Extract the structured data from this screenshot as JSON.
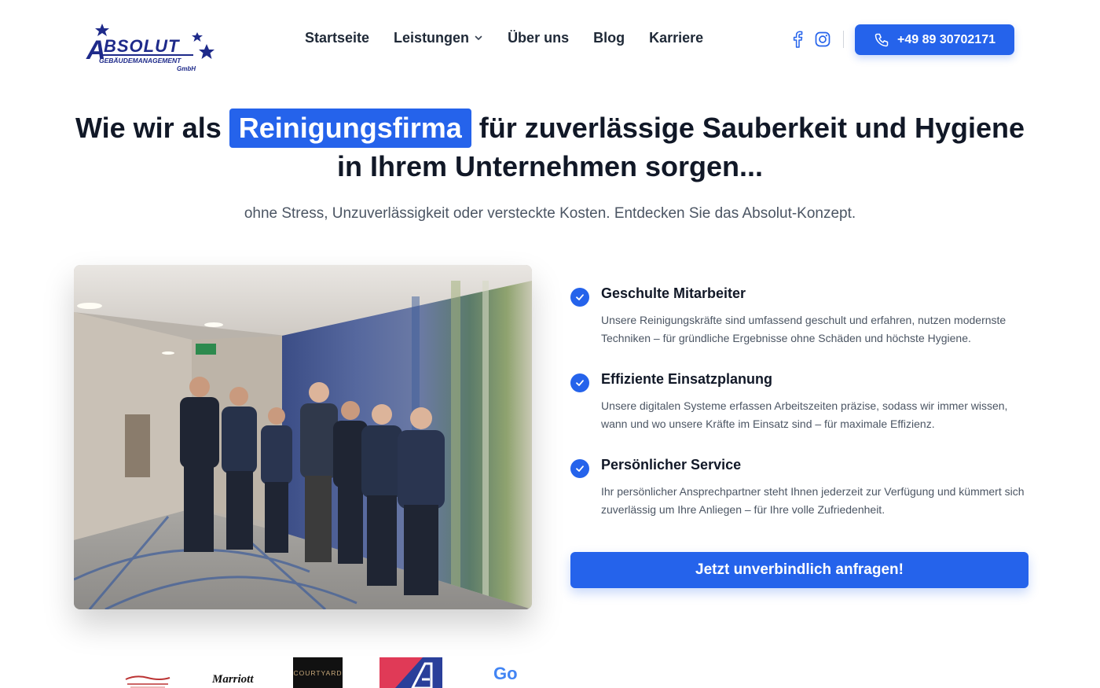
{
  "brand": {
    "logo_text": "ABSOLUT",
    "logo_sub": "GEBÄUDEMANAGEMENT",
    "logo_gmbh": "GmbH",
    "primary_color": "#2563eb"
  },
  "nav": {
    "items": [
      {
        "label": "Startseite"
      },
      {
        "label": "Leistungen",
        "has_dropdown": true
      },
      {
        "label": "Über uns"
      },
      {
        "label": "Blog"
      },
      {
        "label": "Karriere"
      }
    ],
    "social": [
      "facebook-icon",
      "instagram-icon"
    ],
    "phone_label": "+49 89 30702171"
  },
  "hero": {
    "headline_before": "Wie wir als",
    "headline_highlight": "Reinigungsfirma",
    "headline_after": "für zuverlässige Sauberkeit und Hygiene",
    "headline_line2": "in Ihrem Unternehmen sorgen...",
    "subline": "ohne Stress, Unzuverlässigkeit oder versteckte Kosten. Entdecken Sie das Absolut-Konzept."
  },
  "features": [
    {
      "title": "Geschulte Mitarbeiter",
      "text": "Unsere Reinigungskräfte sind umfassend geschult und erfahren, nutzen modernste Techniken – für gründliche Ergebnisse ohne Schäden und höchste Hygiene."
    },
    {
      "title": "Effiziente Einsatzplanung",
      "text": "Unsere digitalen Systeme erfassen Arbeitszeiten präzise, sodass wir immer wissen, wann und wo unsere Kräfte im Einsatz sind – für maximale Effizienz."
    },
    {
      "title": "Persönlicher Service",
      "text": "Ihr persönlicher Ansprechpartner steht Ihnen jederzeit zur Verfügung und kümmert sich zuverlässig um Ihre Anliegen – für Ihre volle Zufriedenheit."
    }
  ],
  "cta_label": "Jetzt unverbindlich anfragen!",
  "clients": {
    "marriott": "Marriott",
    "courtyard": "COURTYARD",
    "google_partial": "Go"
  }
}
